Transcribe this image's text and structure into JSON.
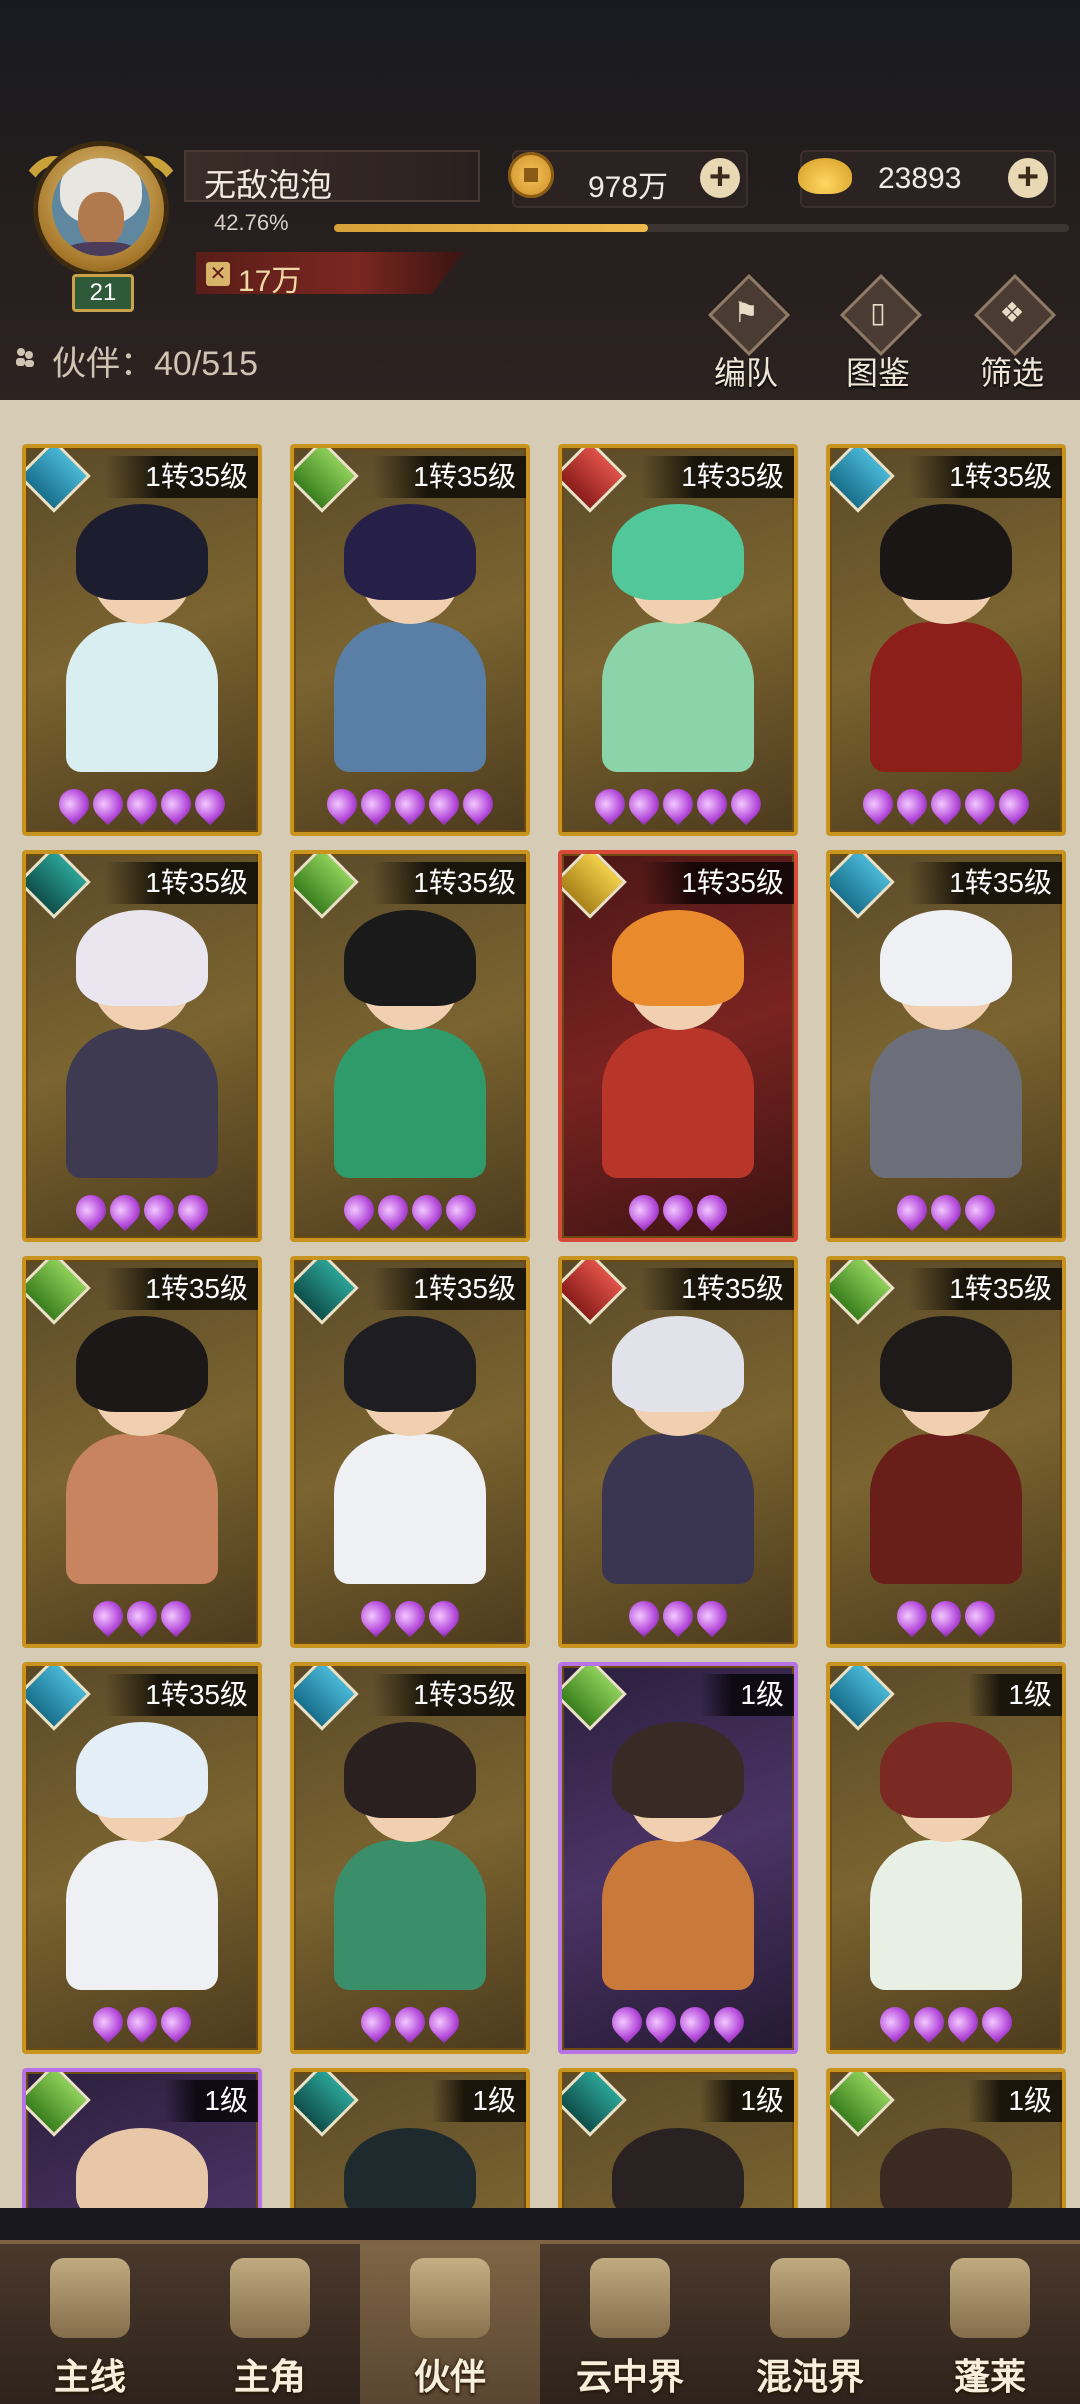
{
  "player": {
    "name": "无敌泡泡",
    "level": "21",
    "exp_percent_text": "42.76%",
    "exp_fraction": 0.4276,
    "power": "17万"
  },
  "currency": {
    "coins": "978万",
    "gold": "23893"
  },
  "partners": {
    "label": "伙伴：40/515"
  },
  "toolbar": {
    "team_label": "编队",
    "codex_label": "图鉴",
    "filter_label": "筛选"
  },
  "cards": [
    {
      "level": "1转35级",
      "element": "water",
      "frame": "gold",
      "stars": 5,
      "hair": "#1c1d2e",
      "cloth": "#d9eef0"
    },
    {
      "level": "1转35级",
      "element": "wood",
      "frame": "gold",
      "stars": 5,
      "hair": "#262049",
      "cloth": "#5a7fa6"
    },
    {
      "level": "1转35级",
      "element": "fire",
      "frame": "gold",
      "stars": 5,
      "hair": "#52c79a",
      "cloth": "#8bd3a8"
    },
    {
      "level": "1转35级",
      "element": "water",
      "frame": "gold",
      "stars": 5,
      "hair": "#1a1616",
      "cloth": "#8c1f1a"
    },
    {
      "level": "1转35级",
      "element": "dark",
      "frame": "gold",
      "stars": 4,
      "hair": "#e9e6f0",
      "cloth": "#3d3a52"
    },
    {
      "level": "1转35级",
      "element": "wood",
      "frame": "gold",
      "stars": 4,
      "hair": "#1a1a1a",
      "cloth": "#2f9a6a"
    },
    {
      "level": "1转35级",
      "element": "gold",
      "frame": "red",
      "stars": 3,
      "hair": "#e98a2c",
      "cloth": "#b8352a"
    },
    {
      "level": "1转35级",
      "element": "water",
      "frame": "gold",
      "stars": 3,
      "hair": "#eef0f4",
      "cloth": "#6c6f7a"
    },
    {
      "level": "1转35级",
      "element": "wood",
      "frame": "gold",
      "stars": 3,
      "hair": "#1c1818",
      "cloth": "#c8845e"
    },
    {
      "level": "1转35级",
      "element": "dark",
      "frame": "gold",
      "stars": 3,
      "hair": "#1e1e22",
      "cloth": "#eef0f4"
    },
    {
      "level": "1转35级",
      "element": "fire",
      "frame": "gold",
      "stars": 3,
      "hair": "#e2e2ea",
      "cloth": "#3a3550"
    },
    {
      "level": "1转35级",
      "element": "wood",
      "frame": "gold",
      "stars": 3,
      "hair": "#1f1a1a",
      "cloth": "#6a1e1a"
    },
    {
      "level": "1转35级",
      "element": "water",
      "frame": "gold",
      "stars": 3,
      "hair": "#e3eef6",
      "cloth": "#eef0f4"
    },
    {
      "level": "1转35级",
      "element": "water",
      "frame": "gold",
      "stars": 3,
      "hair": "#2a2020",
      "cloth": "#3a8e6a"
    },
    {
      "level": "1级",
      "element": "wood",
      "frame": "purple",
      "stars": 4,
      "hair": "#3a2a26",
      "cloth": "#c97a3a"
    },
    {
      "level": "1级",
      "element": "water",
      "frame": "gold",
      "stars": 4,
      "hair": "#7a2a22",
      "cloth": "#e8efe4"
    },
    {
      "level": "1级",
      "element": "wood",
      "frame": "purple",
      "stars": 0,
      "hair": "#e8c7a8",
      "cloth": "#2a2030"
    },
    {
      "level": "1级",
      "element": "dark",
      "frame": "gold",
      "stars": 0,
      "hair": "#1e2a2e",
      "cloth": "#2a3436"
    },
    {
      "level": "1级",
      "element": "dark",
      "frame": "gold",
      "stars": 0,
      "hair": "#2a2222",
      "cloth": "#9a5a2a"
    },
    {
      "level": "1级",
      "element": "wood",
      "frame": "gold",
      "stars": 0,
      "hair": "#3a2a22",
      "cloth": "#d0a070"
    }
  ],
  "nav": [
    {
      "label": "主线",
      "icon": "swords-icon",
      "active": false
    },
    {
      "label": "主角",
      "icon": "hero-icon",
      "active": false
    },
    {
      "label": "伙伴",
      "icon": "partner-icon",
      "active": true
    },
    {
      "label": "云中界",
      "icon": "cloud-realm-icon",
      "active": false
    },
    {
      "label": "混沌界",
      "icon": "chaos-realm-icon",
      "active": false
    },
    {
      "label": "蓬莱",
      "icon": "penglai-icon",
      "active": false
    }
  ]
}
